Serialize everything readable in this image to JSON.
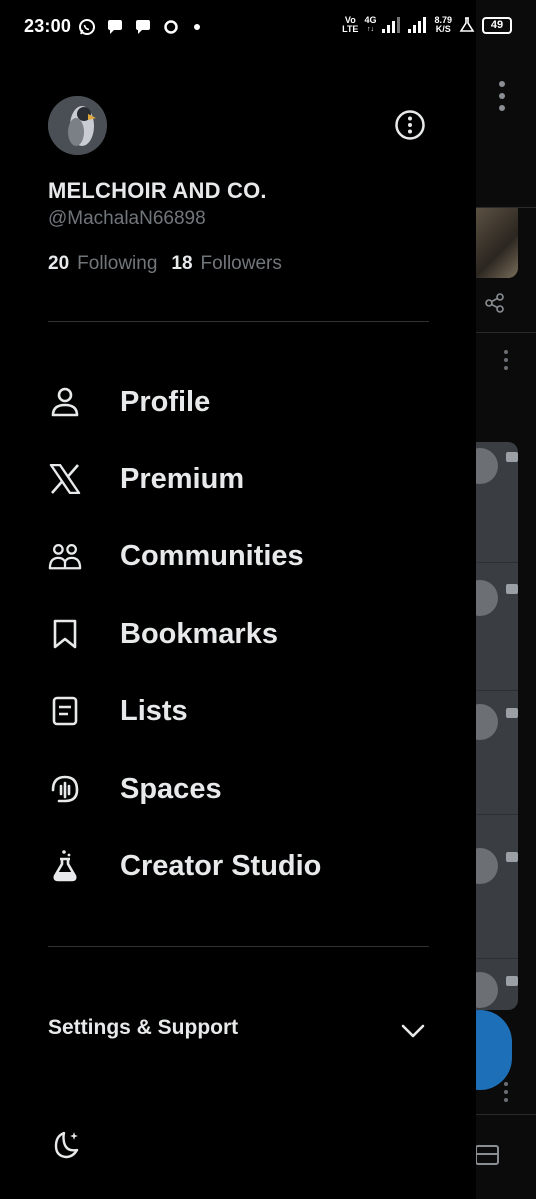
{
  "status_bar": {
    "time": "23:00",
    "net_top": "Vo",
    "net_bottom": "LTE",
    "net_gen": "4G",
    "speed_top": "8.79",
    "speed_bottom": "K/S",
    "battery": "49"
  },
  "profile": {
    "display_name": "MELCHOIR AND CO.",
    "handle": "@MachalaN66898",
    "following_count": "20",
    "following_label": "Following",
    "followers_count": "18",
    "followers_label": "Followers"
  },
  "menu": {
    "items": [
      {
        "label": "Profile",
        "icon": "person-icon"
      },
      {
        "label": "Premium",
        "icon": "x-logo-icon"
      },
      {
        "label": "Communities",
        "icon": "people-icon"
      },
      {
        "label": "Bookmarks",
        "icon": "bookmark-icon"
      },
      {
        "label": "Lists",
        "icon": "list-icon"
      },
      {
        "label": "Spaces",
        "icon": "microphone-icon"
      },
      {
        "label": "Creator Studio",
        "icon": "flask-icon"
      }
    ]
  },
  "settings": {
    "label": "Settings & Support"
  },
  "colors": {
    "background": "#000000",
    "text_primary": "#e7e9ea",
    "text_secondary": "#71767b",
    "divider": "#2f3336"
  }
}
